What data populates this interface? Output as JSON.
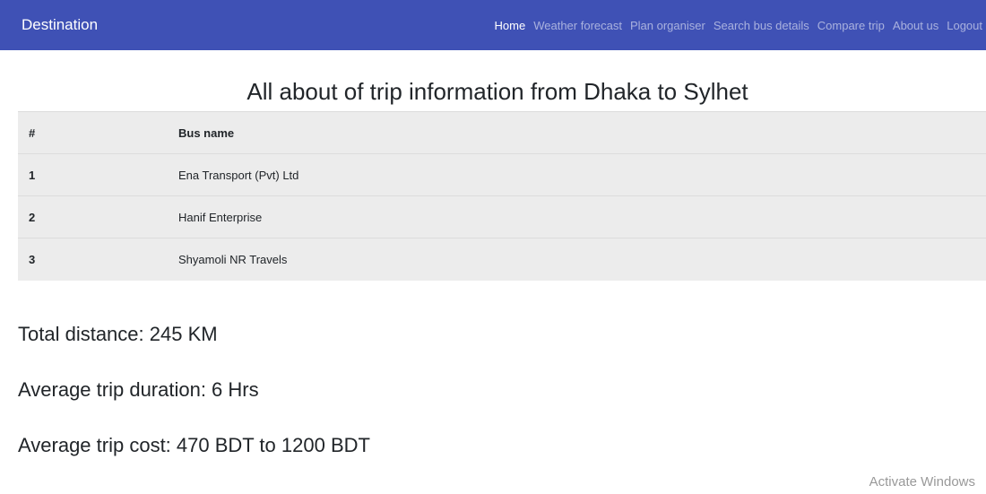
{
  "navbar": {
    "brand": "Destination",
    "links": [
      {
        "label": "Home",
        "active": true
      },
      {
        "label": "Weather forecast",
        "active": false
      },
      {
        "label": "Plan organiser",
        "active": false
      },
      {
        "label": "Search bus details",
        "active": false
      },
      {
        "label": "Compare trip",
        "active": false
      },
      {
        "label": "About us",
        "active": false
      },
      {
        "label": "Logout",
        "active": false
      }
    ]
  },
  "main": {
    "title": "All about of trip information from Dhaka to Sylhet",
    "table": {
      "headers": [
        "#",
        "Bus name"
      ],
      "rows": [
        [
          "1",
          "Ena Transport (Pvt) Ltd"
        ],
        [
          "2",
          "Hanif Enterprise"
        ],
        [
          "3",
          "Shyamoli NR Travels"
        ]
      ]
    },
    "total_distance": "Total distance: 245 KM",
    "avg_duration": "Average trip duration: 6 Hrs",
    "avg_cost": "Average trip cost: 470 BDT to 1200 BDT"
  },
  "system": {
    "watermark": "Activate Windows"
  }
}
